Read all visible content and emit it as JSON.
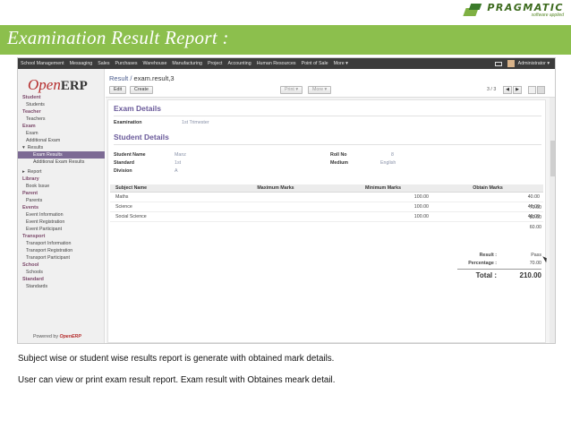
{
  "brand": {
    "name": "PRAGMATIC",
    "tagline": "software applied"
  },
  "slide": {
    "title": "Examination Result Report :",
    "captions": [
      "Subject wise or student wise results report is generate with obtained mark details.",
      "User can view or print exam result report. Exam result with Obtaines meark detail."
    ]
  },
  "colors": {
    "green_band": "#8cbf4d",
    "menu_bar": "#3b3b3b",
    "accent_purple": "#6a5a9a",
    "logo_red": "#b52d2d"
  },
  "topmenu": {
    "items": [
      "School Management",
      "Messaging",
      "Sales",
      "Purchases",
      "Warehouse",
      "Manufacturing",
      "Project",
      "Accounting",
      "Human Resources",
      "Point of Sale",
      "More ▾"
    ],
    "user": "Administrator ▾",
    "icons": [
      "envelope-icon",
      "avatar"
    ]
  },
  "sidebar": {
    "logo_open": "Open",
    "logo_erp": "ERP",
    "powered_prefix": "Powered by ",
    "powered_brand": "OpenERP"
  },
  "toolbar": {
    "breadcrumb_parent": "Result",
    "breadcrumb_sep": " / ",
    "breadcrumb_current": "exam.result,3",
    "edit": "Edit",
    "create": "Create",
    "print": "Print ▾",
    "more": "More ▾",
    "pager": "3 / 3",
    "prev": "◀",
    "next": "▶"
  },
  "form": {
    "exam_details_title": "Exam Details",
    "examination_label": "Examination",
    "examination_value": "1st Trimester",
    "student_details_title": "Student Details",
    "student_name_label": "Student Name",
    "student_name_value": "Manz",
    "standard_label": "Standard",
    "standard_value": "1st",
    "division_label": "Division",
    "division_value": "A",
    "roll_no_label": "Roll No",
    "roll_no_value": "8",
    "medium_label": "Medium",
    "medium_value": "English"
  },
  "table": {
    "headers": [
      "Subject Name",
      "Maximum Marks",
      "Minimum Marks",
      "Obtain Marks"
    ],
    "rows": [
      [
        "Maths",
        "100.00",
        "40.00",
        "70.00"
      ],
      [
        "Science",
        "100.00",
        "40.00",
        "80.00"
      ],
      [
        "Social Science",
        "100.00",
        "40.00",
        "60.00"
      ]
    ]
  },
  "summary": {
    "result_label": "Result :",
    "result_value": "Pass",
    "percentage_label": "Percentage :",
    "percentage_value": "70.00",
    "total_label": "Total :",
    "total_value": "210.00"
  }
}
